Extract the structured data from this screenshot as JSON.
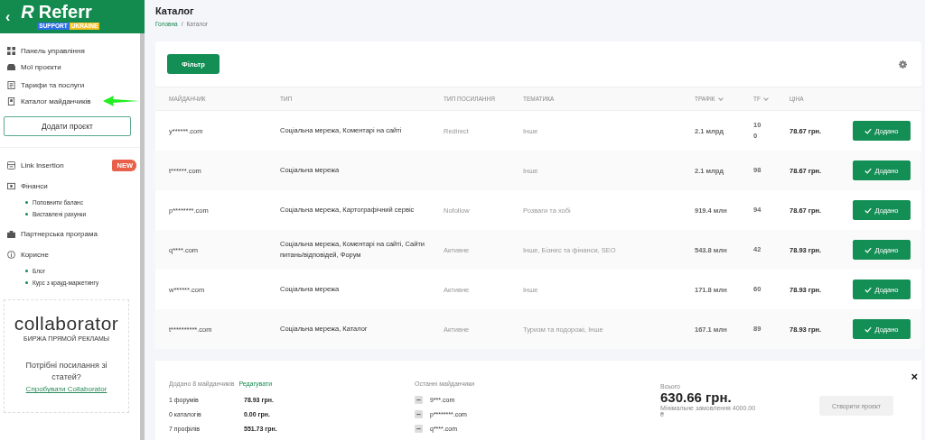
{
  "logo": {
    "mark": "R",
    "name": "Referr",
    "badge_left": "SUPPORT",
    "badge_right": "UKRAINE"
  },
  "back": "‹",
  "sidebar": {
    "items": [
      {
        "label": "Панель управління"
      },
      {
        "label": "Мої проєкти"
      },
      {
        "label": "Тарифи та послуги"
      },
      {
        "label": "Каталог майданчиків"
      }
    ],
    "add_project": "Додати проєкт",
    "items_2": [
      {
        "label": "Link Insertion",
        "badge": "NEW"
      },
      {
        "label": "Фінанси",
        "children": [
          {
            "label": "Поповнити баланс"
          },
          {
            "label": "Виставлені рахунки"
          }
        ]
      },
      {
        "label": "Партнерська програма"
      },
      {
        "label": "Корисне",
        "children": [
          {
            "label": "Блог"
          },
          {
            "label": "Курс з крауд-маркетингу"
          }
        ]
      }
    ],
    "promo": {
      "logo": "collaborator",
      "tagline": "БИРЖА ПРЯМОЙ РЕКЛАМЫ",
      "text": "Потрібні посилання зі статей?",
      "link": "Спробувати Collaborator"
    }
  },
  "page": {
    "title": "Каталог",
    "breadcrumb_separator": "/",
    "breadcrumbs": [
      {
        "label": "Головна",
        "link": true
      },
      {
        "label": "Каталог",
        "link": false
      }
    ]
  },
  "filter_button": "Фільтр",
  "table": {
    "columns": [
      {
        "label": "МАЙДАНЧИК",
        "sortable": false
      },
      {
        "label": "ТИП",
        "sortable": false
      },
      {
        "label": "ТИП ПОСИЛАННЯ",
        "sortable": false
      },
      {
        "label": "ТЕМАТИКА",
        "sortable": false
      },
      {
        "label": "ТРАФІК",
        "sortable": true
      },
      {
        "label": "TF",
        "sortable": true
      },
      {
        "label": "ЦІНА",
        "sortable": false
      }
    ],
    "rows": [
      {
        "site": "y******.com",
        "type": "Соціальна мережа, Коментарі на сайті",
        "link_type": "Redirect",
        "topic": "Інше",
        "traffic": "2.1 млрд",
        "tf": "100",
        "price": "78.67 грн.",
        "added": true,
        "button": "Додано"
      },
      {
        "site": "t******.com",
        "type": "Соціальна мережа",
        "link_type": "",
        "topic": "Інше",
        "traffic": "2.1 млрд",
        "tf": "98",
        "price": "78.67 грн.",
        "added": true,
        "button": "Додано"
      },
      {
        "site": "p********.com",
        "type": "Соціальна мережа, Картографічний сервіс",
        "link_type": "Nofollow",
        "topic": "Розваги та хобі",
        "traffic": "919.4 млн",
        "tf": "94",
        "price": "78.67 грн.",
        "added": true,
        "button": "Додано"
      },
      {
        "site": "q****.com",
        "type": "Соціальна мережа, Коментарі на сайті, Сайти питань/відповідей, Форум",
        "link_type": "Активне",
        "topic": "Інше, Бізнес та фінанси, SEO",
        "traffic": "543.8 млн",
        "tf": "42",
        "price": "78.93 грн.",
        "added": true,
        "button": "Додано"
      },
      {
        "site": "w******.com",
        "type": "Соціальна мережа",
        "link_type": "Активне",
        "topic": "Інше",
        "traffic": "171.8 млн",
        "tf": "60",
        "price": "78.93 грн.",
        "added": true,
        "button": "Додано"
      },
      {
        "site": "t**********.com",
        "type": "Соціальна мережа, Каталог",
        "link_type": "Активне",
        "topic": "Туризм та подорожі, Інше",
        "traffic": "167.1 млн",
        "tf": "89",
        "price": "78.93 грн.",
        "added": true,
        "button": "Додано"
      }
    ]
  },
  "footer": {
    "added_text": "Додано 8 майданчиків",
    "edit_link": "Редагувати",
    "counts": [
      {
        "label": "1 форумів",
        "amount": "78.93 грн."
      },
      {
        "label": "0 каталогів",
        "amount": "0.00 грн."
      },
      {
        "label": "7 профілів",
        "amount": "551.73 грн."
      }
    ],
    "recent_title": "Останні майданчики",
    "recent": [
      "9***.com",
      "p********.com",
      "q****.com"
    ],
    "total_label": "Всього",
    "total": "630.66 грн.",
    "min_order": "Мінімальне замовлення 4000.00",
    "currency": "₴",
    "create_button": {
      "label": "Створити проєкт",
      "disabled": true
    },
    "close": "×"
  }
}
